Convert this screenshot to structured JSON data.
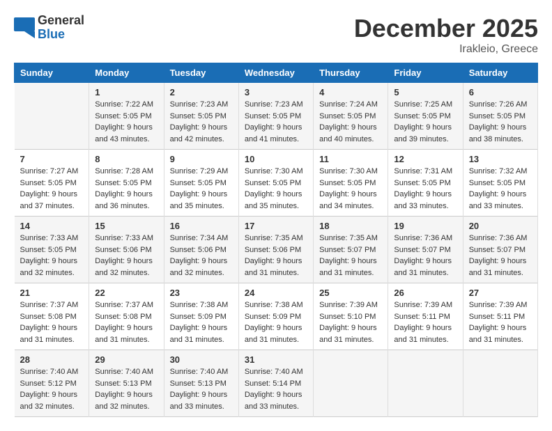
{
  "header": {
    "logo_general": "General",
    "logo_blue": "Blue",
    "month_title": "December 2025",
    "subtitle": "Irakleio, Greece"
  },
  "columns": [
    "Sunday",
    "Monday",
    "Tuesday",
    "Wednesday",
    "Thursday",
    "Friday",
    "Saturday"
  ],
  "weeks": [
    [
      {
        "day": "",
        "sunrise": "",
        "sunset": "",
        "daylight": ""
      },
      {
        "day": "1",
        "sunrise": "Sunrise: 7:22 AM",
        "sunset": "Sunset: 5:05 PM",
        "daylight": "Daylight: 9 hours and 43 minutes."
      },
      {
        "day": "2",
        "sunrise": "Sunrise: 7:23 AM",
        "sunset": "Sunset: 5:05 PM",
        "daylight": "Daylight: 9 hours and 42 minutes."
      },
      {
        "day": "3",
        "sunrise": "Sunrise: 7:23 AM",
        "sunset": "Sunset: 5:05 PM",
        "daylight": "Daylight: 9 hours and 41 minutes."
      },
      {
        "day": "4",
        "sunrise": "Sunrise: 7:24 AM",
        "sunset": "Sunset: 5:05 PM",
        "daylight": "Daylight: 9 hours and 40 minutes."
      },
      {
        "day": "5",
        "sunrise": "Sunrise: 7:25 AM",
        "sunset": "Sunset: 5:05 PM",
        "daylight": "Daylight: 9 hours and 39 minutes."
      },
      {
        "day": "6",
        "sunrise": "Sunrise: 7:26 AM",
        "sunset": "Sunset: 5:05 PM",
        "daylight": "Daylight: 9 hours and 38 minutes."
      }
    ],
    [
      {
        "day": "7",
        "sunrise": "Sunrise: 7:27 AM",
        "sunset": "Sunset: 5:05 PM",
        "daylight": "Daylight: 9 hours and 37 minutes."
      },
      {
        "day": "8",
        "sunrise": "Sunrise: 7:28 AM",
        "sunset": "Sunset: 5:05 PM",
        "daylight": "Daylight: 9 hours and 36 minutes."
      },
      {
        "day": "9",
        "sunrise": "Sunrise: 7:29 AM",
        "sunset": "Sunset: 5:05 PM",
        "daylight": "Daylight: 9 hours and 35 minutes."
      },
      {
        "day": "10",
        "sunrise": "Sunrise: 7:30 AM",
        "sunset": "Sunset: 5:05 PM",
        "daylight": "Daylight: 9 hours and 35 minutes."
      },
      {
        "day": "11",
        "sunrise": "Sunrise: 7:30 AM",
        "sunset": "Sunset: 5:05 PM",
        "daylight": "Daylight: 9 hours and 34 minutes."
      },
      {
        "day": "12",
        "sunrise": "Sunrise: 7:31 AM",
        "sunset": "Sunset: 5:05 PM",
        "daylight": "Daylight: 9 hours and 33 minutes."
      },
      {
        "day": "13",
        "sunrise": "Sunrise: 7:32 AM",
        "sunset": "Sunset: 5:05 PM",
        "daylight": "Daylight: 9 hours and 33 minutes."
      }
    ],
    [
      {
        "day": "14",
        "sunrise": "Sunrise: 7:33 AM",
        "sunset": "Sunset: 5:05 PM",
        "daylight": "Daylight: 9 hours and 32 minutes."
      },
      {
        "day": "15",
        "sunrise": "Sunrise: 7:33 AM",
        "sunset": "Sunset: 5:06 PM",
        "daylight": "Daylight: 9 hours and 32 minutes."
      },
      {
        "day": "16",
        "sunrise": "Sunrise: 7:34 AM",
        "sunset": "Sunset: 5:06 PM",
        "daylight": "Daylight: 9 hours and 32 minutes."
      },
      {
        "day": "17",
        "sunrise": "Sunrise: 7:35 AM",
        "sunset": "Sunset: 5:06 PM",
        "daylight": "Daylight: 9 hours and 31 minutes."
      },
      {
        "day": "18",
        "sunrise": "Sunrise: 7:35 AM",
        "sunset": "Sunset: 5:07 PM",
        "daylight": "Daylight: 9 hours and 31 minutes."
      },
      {
        "day": "19",
        "sunrise": "Sunrise: 7:36 AM",
        "sunset": "Sunset: 5:07 PM",
        "daylight": "Daylight: 9 hours and 31 minutes."
      },
      {
        "day": "20",
        "sunrise": "Sunrise: 7:36 AM",
        "sunset": "Sunset: 5:07 PM",
        "daylight": "Daylight: 9 hours and 31 minutes."
      }
    ],
    [
      {
        "day": "21",
        "sunrise": "Sunrise: 7:37 AM",
        "sunset": "Sunset: 5:08 PM",
        "daylight": "Daylight: 9 hours and 31 minutes."
      },
      {
        "day": "22",
        "sunrise": "Sunrise: 7:37 AM",
        "sunset": "Sunset: 5:08 PM",
        "daylight": "Daylight: 9 hours and 31 minutes."
      },
      {
        "day": "23",
        "sunrise": "Sunrise: 7:38 AM",
        "sunset": "Sunset: 5:09 PM",
        "daylight": "Daylight: 9 hours and 31 minutes."
      },
      {
        "day": "24",
        "sunrise": "Sunrise: 7:38 AM",
        "sunset": "Sunset: 5:09 PM",
        "daylight": "Daylight: 9 hours and 31 minutes."
      },
      {
        "day": "25",
        "sunrise": "Sunrise: 7:39 AM",
        "sunset": "Sunset: 5:10 PM",
        "daylight": "Daylight: 9 hours and 31 minutes."
      },
      {
        "day": "26",
        "sunrise": "Sunrise: 7:39 AM",
        "sunset": "Sunset: 5:11 PM",
        "daylight": "Daylight: 9 hours and 31 minutes."
      },
      {
        "day": "27",
        "sunrise": "Sunrise: 7:39 AM",
        "sunset": "Sunset: 5:11 PM",
        "daylight": "Daylight: 9 hours and 31 minutes."
      }
    ],
    [
      {
        "day": "28",
        "sunrise": "Sunrise: 7:40 AM",
        "sunset": "Sunset: 5:12 PM",
        "daylight": "Daylight: 9 hours and 32 minutes."
      },
      {
        "day": "29",
        "sunrise": "Sunrise: 7:40 AM",
        "sunset": "Sunset: 5:13 PM",
        "daylight": "Daylight: 9 hours and 32 minutes."
      },
      {
        "day": "30",
        "sunrise": "Sunrise: 7:40 AM",
        "sunset": "Sunset: 5:13 PM",
        "daylight": "Daylight: 9 hours and 33 minutes."
      },
      {
        "day": "31",
        "sunrise": "Sunrise: 7:40 AM",
        "sunset": "Sunset: 5:14 PM",
        "daylight": "Daylight: 9 hours and 33 minutes."
      },
      {
        "day": "",
        "sunrise": "",
        "sunset": "",
        "daylight": ""
      },
      {
        "day": "",
        "sunrise": "",
        "sunset": "",
        "daylight": ""
      },
      {
        "day": "",
        "sunrise": "",
        "sunset": "",
        "daylight": ""
      }
    ]
  ]
}
